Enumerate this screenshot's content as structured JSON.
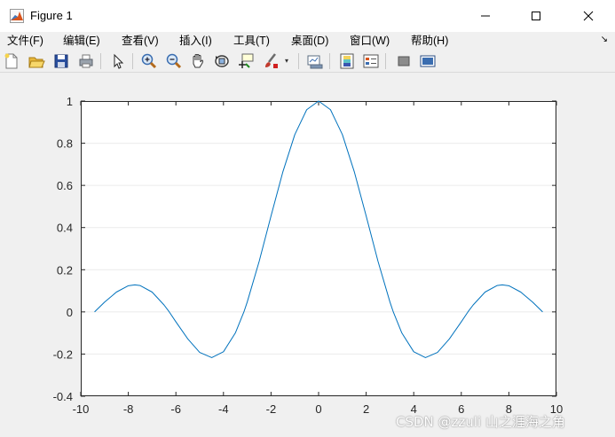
{
  "window": {
    "title": "Figure 1"
  },
  "menu": {
    "items": [
      {
        "label": "文件(F)"
      },
      {
        "label": "编辑(E)"
      },
      {
        "label": "查看(V)"
      },
      {
        "label": "插入(I)"
      },
      {
        "label": "工具(T)"
      },
      {
        "label": "桌面(D)"
      },
      {
        "label": "窗口(W)"
      },
      {
        "label": "帮助(H)"
      }
    ]
  },
  "toolbar": {
    "icons": [
      "new-figure-icon",
      "open-file-icon",
      "save-icon",
      "print-icon",
      "edit-plot-arrow-icon",
      "zoom-in-icon",
      "zoom-out-icon",
      "pan-hand-icon",
      "rotate-3d-icon",
      "data-cursor-icon",
      "brush-icon",
      "link-plot-icon",
      "colorbar-icon",
      "legend-icon",
      "hide-plot-tools-icon",
      "show-plot-tools-icon"
    ]
  },
  "colors": {
    "line": "#0072bd",
    "axes_bg": "#ffffff",
    "grid": "#ebebeb",
    "axis": "#262626"
  },
  "chart_data": {
    "type": "line",
    "title": "",
    "xlabel": "",
    "ylabel": "",
    "xlim": [
      -10,
      10
    ],
    "ylim": [
      -0.4,
      1
    ],
    "xticks": [
      -10,
      -8,
      -6,
      -4,
      -2,
      0,
      2,
      4,
      6,
      8,
      10
    ],
    "yticks": [
      -0.4,
      -0.2,
      0,
      0.2,
      0.4,
      0.6,
      0.8,
      1
    ],
    "ygrid": true,
    "xgrid": false,
    "series": [
      {
        "x": [
          -9.42,
          -9.0,
          -8.5,
          -8.0,
          -7.725,
          -7.5,
          -7.0,
          -6.5,
          -6.28,
          -6.0,
          -5.5,
          -5.0,
          -4.493,
          -4.0,
          -3.5,
          -3.14,
          -3.0,
          -2.5,
          -2.0,
          -1.5,
          -1.0,
          -0.5,
          0,
          0.5,
          1.0,
          1.5,
          2.0,
          2.5,
          3.0,
          3.14,
          3.5,
          4.0,
          4.493,
          5.0,
          5.5,
          6.0,
          6.28,
          6.5,
          7.0,
          7.5,
          7.725,
          8.0,
          8.5,
          9.0,
          9.42
        ],
        "y": [
          0.0,
          0.046,
          0.094,
          0.124,
          0.128,
          0.125,
          0.094,
          0.033,
          0.0,
          -0.047,
          -0.128,
          -0.192,
          -0.217,
          -0.189,
          -0.1,
          0.0,
          0.047,
          0.239,
          0.455,
          0.665,
          0.841,
          0.959,
          1.0,
          0.959,
          0.841,
          0.665,
          0.455,
          0.239,
          0.047,
          0.0,
          -0.1,
          -0.189,
          -0.217,
          -0.192,
          -0.128,
          -0.047,
          0.0,
          0.033,
          0.094,
          0.125,
          0.128,
          0.124,
          0.094,
          0.046,
          0.0
        ]
      }
    ]
  },
  "watermark": "CSDN @zzuli 山之涯海之角"
}
